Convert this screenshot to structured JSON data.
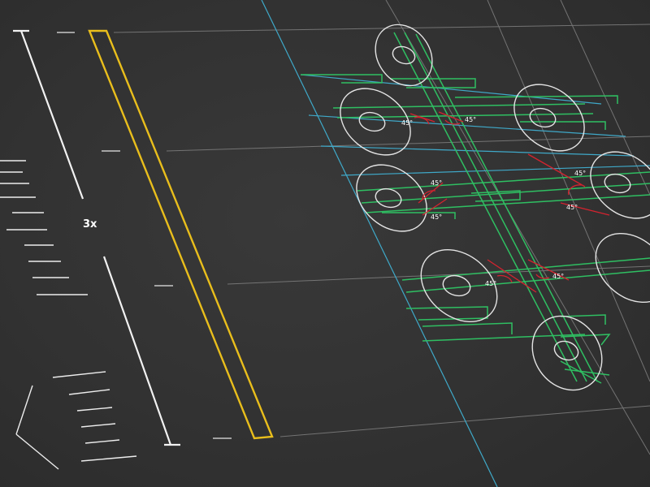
{
  "diagram": {
    "scale_label": "3x",
    "angle_labels": [
      "45°",
      "45°",
      "45°",
      "45°",
      "45°",
      "45°",
      "45°",
      "45°"
    ]
  },
  "colors": {
    "background": "#333333",
    "guide_white": "#d8d8d8",
    "guide_cyan": "#3fa9c9",
    "frame_green": "#2fbf62",
    "angle_red": "#d4232f",
    "ruler_yellow": "#e9be1c"
  }
}
